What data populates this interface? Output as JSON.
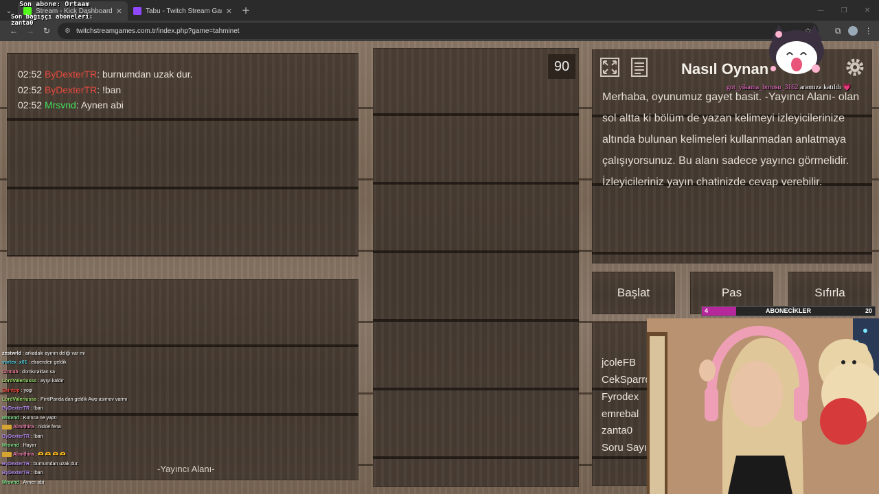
{
  "browser": {
    "tabs": [
      {
        "title": "Stream - Kick Dashboard",
        "active": true,
        "favicon_color": "#53fc18"
      },
      {
        "title": "Tabu - Twitch Stream Games",
        "active": false,
        "favicon_color": "#9146ff"
      }
    ],
    "url": "twitchstreamgames.com.tr/index.php?game=tahminet"
  },
  "overlay": {
    "last_sub": "Son abone: Ortaam",
    "donors_label": "Son bağışçı aboneleri:",
    "donors_value": "zanta0"
  },
  "game_chat": [
    {
      "time": "02:52",
      "user": "ByDexterTR",
      "user_color": "#e8493f",
      "message": ": burnumdan uzak dur."
    },
    {
      "time": "02:52",
      "user": "ByDexterTR",
      "user_color": "#e8493f",
      "message": ": !ban"
    },
    {
      "time": "02:52",
      "user": "Mrsvnd",
      "user_color": "#3ee05a",
      "message": ": Aynen abi"
    }
  ],
  "timer": "90",
  "info": {
    "title": "Nasıl Oynan",
    "text": "Merhaba, oyunumuz gayet basit. -Yayıncı Alanı- olan sol altta ki bölüm de yazan kelimeyi izleyicilerinize altında bulunan kelimeleri kullanmadan anlatmaya çalışıyorsunuz. Bu alanı sadece yayıncı görmelidir. İzleyicileriniz yayın chatinizde cevap verebilir."
  },
  "icons": {
    "fullscreen": "fullscreen-icon",
    "document": "document-icon",
    "settings": "gear-icon"
  },
  "buttons": {
    "start": "Başlat",
    "pass": "Pas",
    "reset": "Sıfırla"
  },
  "players": [
    "jcoleFB",
    "CekSparro",
    "Fyrodex",
    "emrebal",
    "zanta0",
    "Soru Sayıs"
  ],
  "streamer_area_label": "-Yayıncı Alanı-",
  "kick_chat": [
    {
      "user": "zestwrld",
      "color": "#ffffff",
      "message": " : arkadaki ayının deliği var mı",
      "badge": false
    },
    {
      "user": "vortex_x01",
      "color": "#4fd1e0",
      "message": " : elraenden geldik",
      "badge": false
    },
    {
      "user": "Cinti45",
      "color": "#f07f9a",
      "message": " : domkıraldan sa",
      "badge": false
    },
    {
      "user": "LordValeriusss",
      "color": "#9be36b",
      "message": " : ayıyı kaldır",
      "badge": false
    },
    {
      "user": "Saintpp",
      "color": "#e0443a",
      "message": " : yogi",
      "badge": false
    },
    {
      "user": "LordValeriusss",
      "color": "#9be36b",
      "message": " : PintiPanda dan geldik Awp asimov varmı",
      "badge": false
    },
    {
      "user": "ByDexterTR",
      "color": "#b48cf0",
      "message": " : !ban",
      "badge": false
    },
    {
      "user": "Mrsvnd",
      "color": "#7be38a",
      "message": " : Kırınca ne yaptı",
      "badge": false
    },
    {
      "user": "Almithira",
      "color": "#f07fb0",
      "message": " : nickle fena",
      "badge": true
    },
    {
      "user": "ByDexterTR",
      "color": "#b48cf0",
      "message": " : !ban",
      "badge": false
    },
    {
      "user": "Mrsvnd",
      "color": "#7be38a",
      "message": " : Hayırr",
      "badge": false
    },
    {
      "user": "Almithira",
      "color": "#f07fb0",
      "message": " : 🫶 🫶 🫶 🫶",
      "badge": true
    },
    {
      "user": "ByDexterTR",
      "color": "#b48cf0",
      "message": " : burnumdan uzak dur.",
      "badge": false
    },
    {
      "user": "ByDexterTR",
      "color": "#b48cf0",
      "message": " : !ban",
      "badge": false
    },
    {
      "user": "Mrsvnd",
      "color": "#7be38a",
      "message": " : Aynen abi",
      "badge": false
    }
  ],
  "sub_goal": {
    "current": "4",
    "label": "ABONECİKLER",
    "goal": "20",
    "fraction": 0.2,
    "color": "#b5279b"
  },
  "alert": {
    "user": "got_yikama_borusu_3162",
    "message": " aramıza katıldı 💗"
  }
}
